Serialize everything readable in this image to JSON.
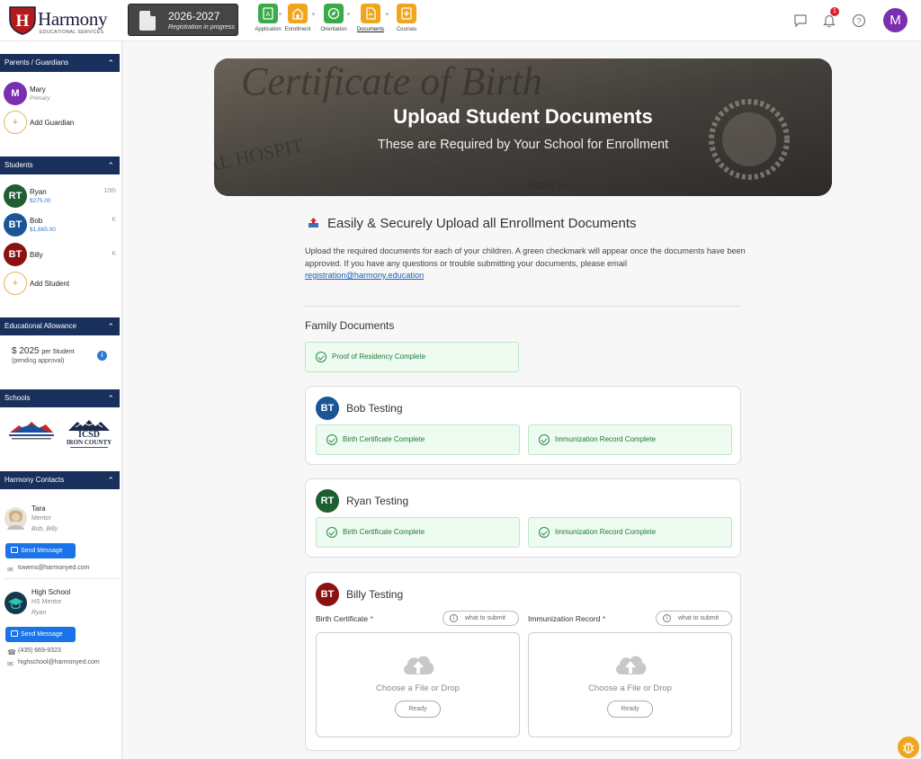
{
  "header": {
    "brand": "Harmony",
    "brand_tagline": "EDUCATIONAL SERVICES",
    "year": "2026-2027",
    "year_status": "Registration in progress",
    "steps": [
      {
        "label": "Application",
        "color": "#3bab4a",
        "icon": "application-icon"
      },
      {
        "label": "Enrollment",
        "color": "#f0a51c",
        "icon": "school-icon"
      },
      {
        "label": "Orientation",
        "color": "#3bab4a",
        "icon": "compass-icon"
      },
      {
        "label": "Documents",
        "color": "#f0a51c",
        "icon": "document-icon",
        "active": true
      },
      {
        "label": "Courses",
        "color": "#f0a51c",
        "icon": "courses-icon"
      }
    ],
    "notification_count": "1",
    "user_initial": "M"
  },
  "sidebar": {
    "guardians": {
      "title": "Parents / Guardians",
      "items": [
        {
          "initial": "M",
          "name": "Mary",
          "role": "Primary"
        }
      ],
      "add_label": "Add Guardian"
    },
    "students": {
      "title": "Students",
      "items": [
        {
          "initials": "RT",
          "name": "Ryan",
          "amount": "$275.00",
          "grade": "10th",
          "color": "#1e5e32"
        },
        {
          "initials": "BT",
          "name": "Bob",
          "amount": "$1,665.00",
          "grade": "K",
          "color": "#1b5596"
        },
        {
          "initials": "BT",
          "name": "Billy",
          "amount": "",
          "grade": "K",
          "color": "#8b1212"
        }
      ],
      "add_label": "Add Student"
    },
    "allowance": {
      "title": "Educational Allowance",
      "amount": "$ 2025",
      "per": "per Student",
      "note": "(pending approval)"
    },
    "schools": {
      "title": "Schools"
    },
    "contacts": {
      "title": "Harmony Contacts",
      "items": [
        {
          "name": "Tara",
          "role": "Mentor",
          "for": "Bob, Billy",
          "button": "Send Message",
          "email": "towens@harmonyed.com"
        },
        {
          "name": "High School",
          "role": "HS Mentor",
          "for": "Ryan",
          "button": "Send Message",
          "phone": "(435) 669-9323",
          "email": "highschool@harmonyed.com"
        }
      ]
    }
  },
  "main": {
    "hero": {
      "title": "Upload Student Documents",
      "subtitle": "These are Required by Your School for Enrollment"
    },
    "intro": {
      "heading": "Easily & Securely Upload all Enrollment Documents",
      "body": "Upload the required documents for each of your children. A green checkmark will appear once the documents have been approved. If you have any questions or trouble submitting your documents, please email ",
      "email": "registration@harmony.education"
    },
    "family": {
      "heading": "Family Documents",
      "items": [
        "Proof of Residency Complete"
      ]
    },
    "students": [
      {
        "initials": "BT",
        "name": "Bob Testing",
        "color": "#1b5596",
        "docs": [
          "Birth Certificate Complete",
          "Immunization Record Complete"
        ]
      },
      {
        "initials": "RT",
        "name": "Ryan Testing",
        "color": "#1e5e32",
        "docs": [
          "Birth Certificate Complete",
          "Immunization Record Complete"
        ]
      },
      {
        "initials": "BT",
        "name": "Billy Testing",
        "color": "#8b1212",
        "uploads": [
          {
            "label": "Birth Certificate",
            "req": "*",
            "help": "what to submit",
            "drop_text": "Choose a File or Drop",
            "status": "Ready"
          },
          {
            "label": "Immunization Record",
            "req": "*",
            "help": "what to submit",
            "drop_text": "Choose a File or Drop",
            "status": "Ready"
          }
        ]
      }
    ]
  }
}
